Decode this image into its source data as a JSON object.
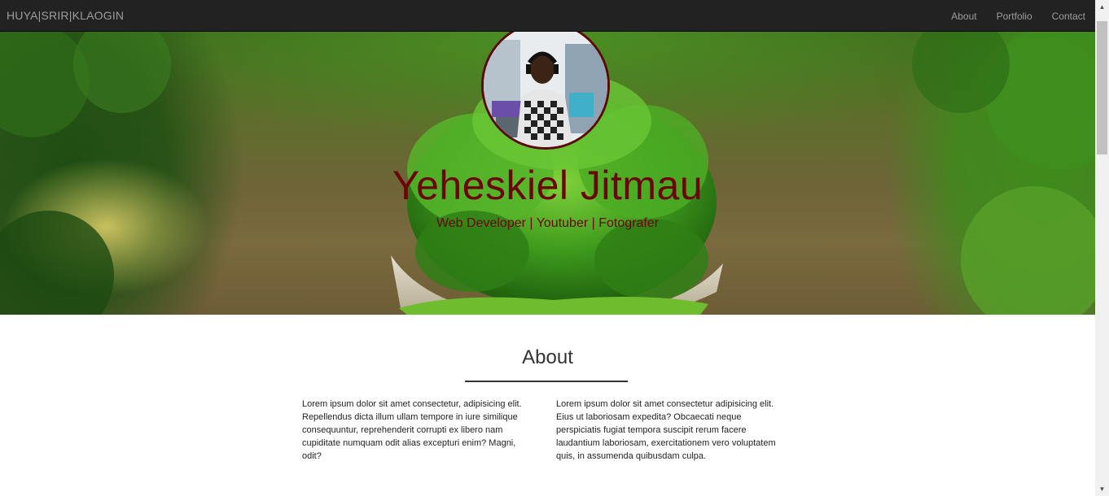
{
  "navbar": {
    "brand": "HUYA|SRIR|KLAOGIN",
    "links": [
      "About",
      "Portfolio",
      "Contact"
    ]
  },
  "hero": {
    "name": "Yeheskiel Jitmau",
    "tagline": "Web Developer | Youtuber | Fotografer"
  },
  "about": {
    "title": "About",
    "paragraphs": [
      "Lorem ipsum dolor sit amet consectetur, adipisicing elit. Repellendus dicta illum ullam tempore in iure similique consequuntur, reprehenderit corrupti ex libero nam cupiditate numquam odit alias excepturi enim? Magni, odit?",
      "Lorem ipsum dolor sit amet consectetur adipisicing elit. Eius ut laboriosam expedita? Obcaecati neque perspiciatis fugiat tempora suscipit rerum facere laudantium laboriosam, exercitationem vero voluptatem quis, in assumenda quibusdam culpa."
    ]
  },
  "colors": {
    "navbar_bg": "#222222",
    "nav_text": "#9d9d9d",
    "hero_text": "#6b0508",
    "body_text": "#333333"
  },
  "icons": {
    "scroll_up": "scroll-up-arrow-icon",
    "scroll_down": "scroll-down-arrow-icon"
  }
}
